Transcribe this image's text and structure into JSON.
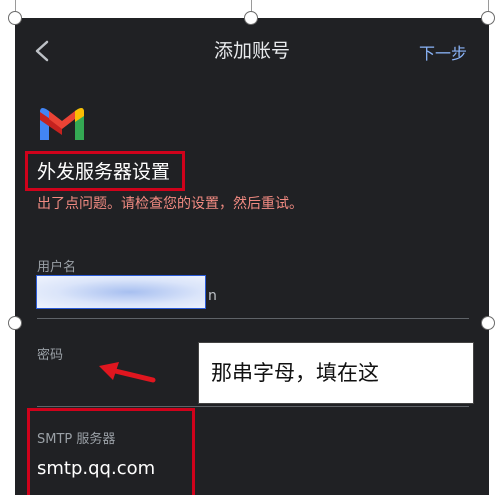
{
  "nav": {
    "back_icon": "chevron-left-icon",
    "title": "添加账号",
    "next_label": "下一步"
  },
  "logo_icon": "gmail-logo-icon",
  "page_title": "外发服务器设置",
  "error_message": "出了点问题。请检查您的设置，然后重试。",
  "fields": {
    "username": {
      "label": "用户名",
      "value_tail": "n"
    },
    "password": {
      "label": "密码",
      "value": ""
    },
    "smtp_server": {
      "label": "SMTP 服务器",
      "value": "smtp.qq.com"
    }
  },
  "annotation": {
    "text": "那串字母，填在这",
    "arrow_icon": "red-arrow-icon"
  },
  "colors": {
    "background": "#202124",
    "accent": "#8ab4f8",
    "error": "#f28b82",
    "highlight": "#d0021b"
  }
}
